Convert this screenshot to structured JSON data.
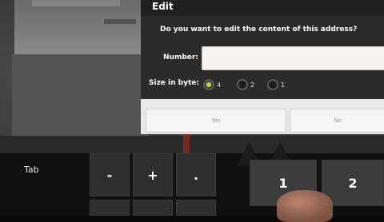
{
  "dialog": {
    "title": "Edit",
    "question": "Do you want to edit the content of this address?",
    "number_label": "Number:",
    "number_value": "",
    "size_label": "Size in byte:",
    "size_options": [
      {
        "label": "4",
        "selected": true
      },
      {
        "label": "2",
        "selected": false
      },
      {
        "label": "1",
        "selected": false
      }
    ],
    "yes_label": "Yes",
    "no_label": "No"
  },
  "keyboard": {
    "tab_label": "Tab",
    "keys_row1": [
      "-",
      "+",
      ".",
      "1",
      "2"
    ],
    "accent_selected": "#b9dd3a"
  }
}
